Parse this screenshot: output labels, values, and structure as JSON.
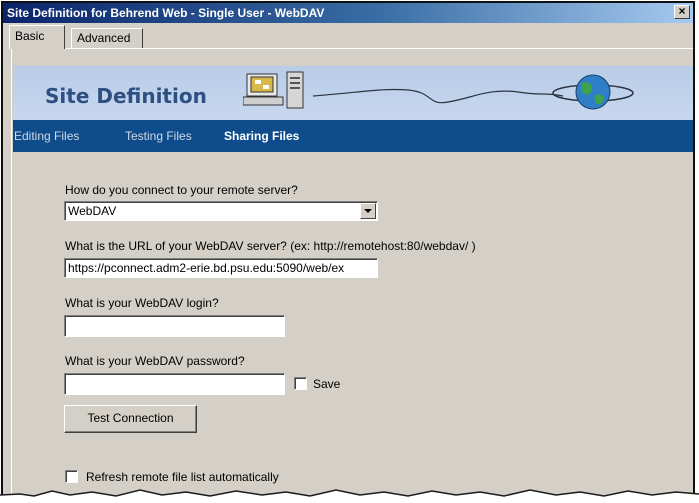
{
  "window": {
    "title": "Site Definition for Behrend Web - Single User - WebDAV",
    "close_label": "×"
  },
  "tabs": [
    {
      "label": "Basic"
    },
    {
      "label": "Advanced"
    }
  ],
  "banner": {
    "title": "Site Definition"
  },
  "nav": [
    {
      "label": "Editing Files"
    },
    {
      "label": "Testing Files"
    },
    {
      "label": "Sharing Files"
    }
  ],
  "form": {
    "connect_label": "How do you connect to your remote server?",
    "connect_value": "WebDAV",
    "url_label": "What is the URL of your WebDAV server? (ex: http://remotehost:80/webdav/ )",
    "url_value": "https://pconnect.adm2-erie.bd.psu.edu:5090/web/ex",
    "login_label": "What is your WebDAV login?",
    "login_value": "",
    "password_label": "What is your WebDAV password?",
    "password_value": "",
    "save_label": "Save",
    "test_button": "Test Connection",
    "refresh_label": "Refresh remote file list automatically"
  },
  "colors": {
    "title_bar": "#0a246a",
    "banner": "#c4d5ed",
    "nav_bar": "#0e4c8c",
    "window_bg": "#d4d0c8"
  }
}
